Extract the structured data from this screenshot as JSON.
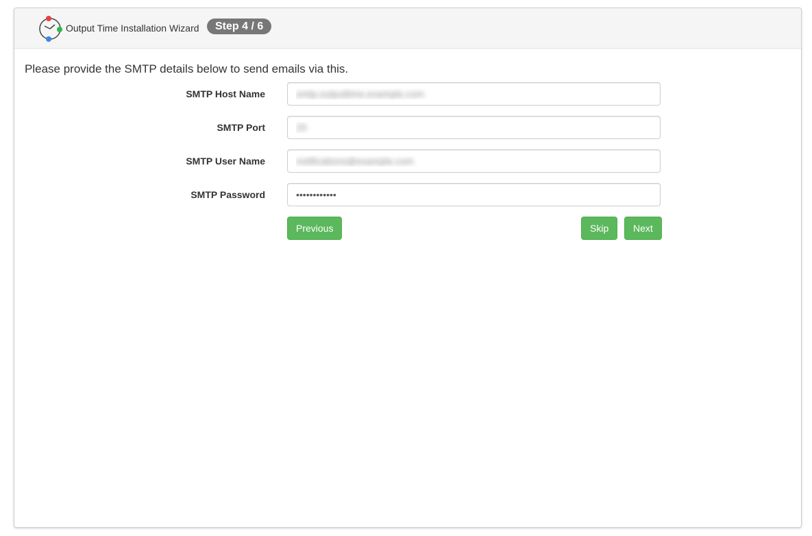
{
  "header": {
    "app_title": "Output Time Installation Wizard",
    "step_badge": "Step 4 / 6",
    "logo_icon": "clock-logo-icon",
    "logo_colors": [
      "#e84040",
      "#2eb84a",
      "#3a86e8"
    ]
  },
  "intro_text": "Please provide the SMTP details below to send emails via this.",
  "form": {
    "host": {
      "label": "SMTP Host Name",
      "value": "smtp.outputtime.example.com"
    },
    "port": {
      "label": "SMTP Port",
      "value": "25"
    },
    "user": {
      "label": "SMTP User Name",
      "value": "notifications@example.com"
    },
    "password": {
      "label": "SMTP Password",
      "value": "••••••••••••"
    }
  },
  "buttons": {
    "previous": "Previous",
    "skip": "Skip",
    "next": "Next"
  },
  "colors": {
    "accent_green": "#5cb85c",
    "badge_gray": "#777777"
  }
}
